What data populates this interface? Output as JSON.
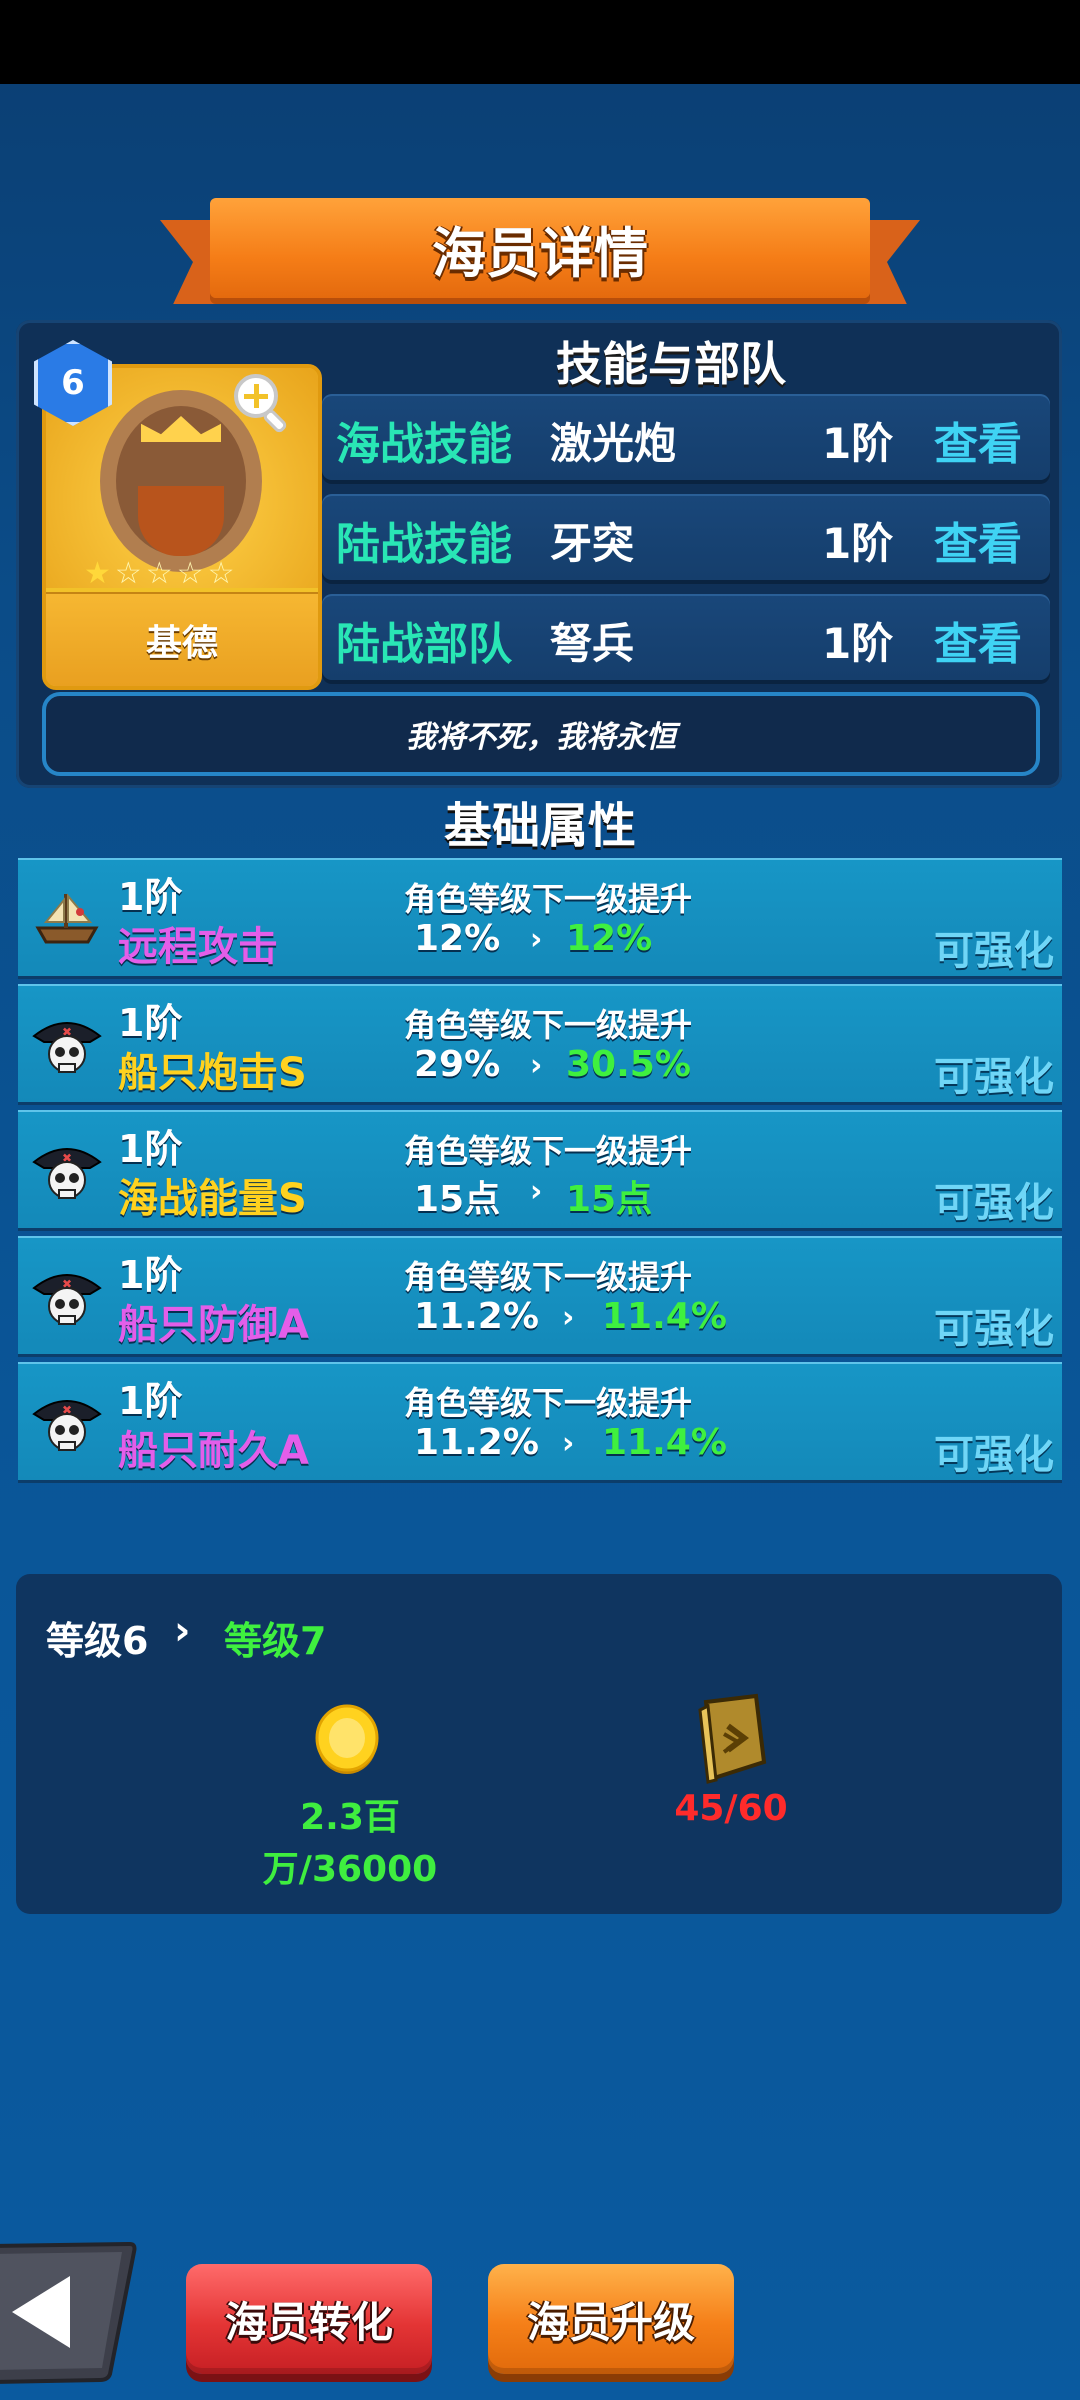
{
  "header": {
    "title": "海员详情"
  },
  "crew": {
    "level": "6",
    "name": "基德",
    "stars_filled": 1,
    "stars_total": 5,
    "quote": "我将不死，我将永恒"
  },
  "skills": {
    "title": "技能与部队",
    "rows": [
      {
        "category": "海战技能",
        "name": "激光炮",
        "tier": "1阶",
        "action": "查看"
      },
      {
        "category": "陆战技能",
        "name": "牙突",
        "tier": "1阶",
        "action": "查看"
      },
      {
        "category": "陆战部队",
        "name": "弩兵",
        "tier": "1阶",
        "action": "查看"
      }
    ]
  },
  "attributes": {
    "title": "基础属性",
    "rows": [
      {
        "icon": "ship-icon",
        "tier": "1阶",
        "name": "远程攻击",
        "name_color": "purple",
        "hint": "角色等级下一级提升",
        "current": "12%",
        "next": "12%",
        "action": "可强化"
      },
      {
        "icon": "pirate-skull-icon",
        "tier": "1阶",
        "name": "船只炮击S",
        "name_color": "gold",
        "hint": "角色等级下一级提升",
        "current": "29%",
        "next": "30.5%",
        "action": "可强化"
      },
      {
        "icon": "pirate-skull-icon",
        "tier": "1阶",
        "name": "海战能量S",
        "name_color": "gold",
        "hint": "角色等级下一级提升",
        "current": "15点",
        "next": "15点",
        "action": "可强化"
      },
      {
        "icon": "pirate-skull-icon",
        "tier": "1阶",
        "name": "船只防御A",
        "name_color": "purple",
        "hint": "角色等级下一级提升",
        "current": "11.2%",
        "next": "11.4%",
        "action": "可强化"
      },
      {
        "icon": "pirate-skull-icon",
        "tier": "1阶",
        "name": "船只耐久A",
        "name_color": "purple",
        "hint": "角色等级下一级提升",
        "current": "11.2%",
        "next": "11.4%",
        "action": "可强化"
      }
    ]
  },
  "upgrade": {
    "from_level": "等级6",
    "to_level": "等级7",
    "gold_cost": "2.3百万/36000",
    "book_cost": "45/60"
  },
  "buttons": {
    "convert": "海员转化",
    "upgrade": "海员升级"
  }
}
